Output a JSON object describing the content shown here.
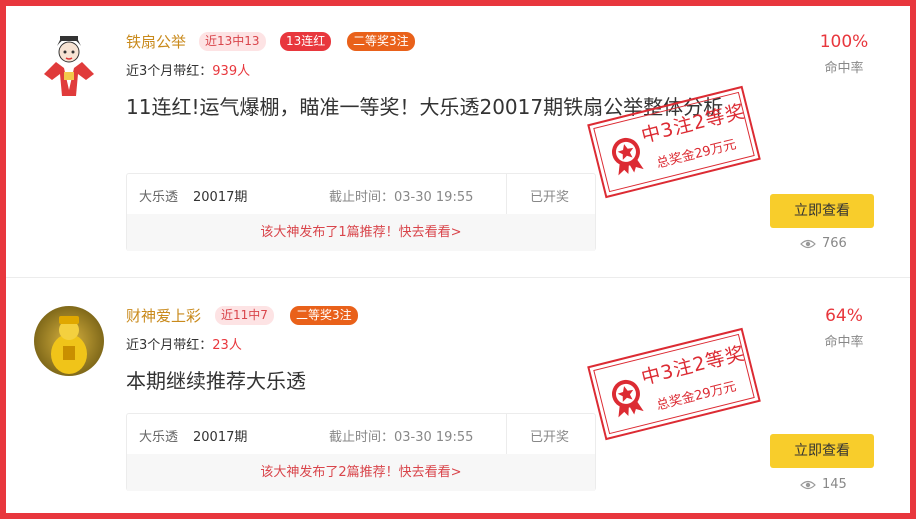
{
  "posts": [
    {
      "author": "铁扇公举",
      "tags": [
        "近13中13",
        "13连红",
        "二等奖3注"
      ],
      "stat_label": "近3个月带红：",
      "stat_value": "939人",
      "title": "11连红!运气爆棚，瞄准一等奖！大乐透20017期铁扇公举整体分析",
      "lottery": "大乐透",
      "issue": "20017期",
      "deadline": "截止时间：03-30 19:55",
      "status": "已开奖",
      "notice": "该大神发布了1篇推荐！快去看看>",
      "hit_rate": "100%",
      "hit_rate_label": "命中率",
      "button": "立即查看",
      "views": "766",
      "stamp_line1": "中3注2等奖",
      "stamp_line2": "总奖金29万元"
    },
    {
      "author": "财神爱上彩",
      "tags": [
        "近11中7",
        "二等奖3注"
      ],
      "stat_label": "近3个月带红：",
      "stat_value": "23人",
      "title": "本期继续推荐大乐透",
      "lottery": "大乐透",
      "issue": "20017期",
      "deadline": "截止时间：03-30 19:55",
      "status": "已开奖",
      "notice": "该大神发布了2篇推荐！快去看看>",
      "hit_rate": "64%",
      "hit_rate_label": "命中率",
      "button": "立即查看",
      "views": "145",
      "stamp_line1": "中3注2等奖",
      "stamp_line2": "总奖金29万元"
    }
  ],
  "colors": {
    "frame": "#e8373d",
    "accent": "#e8373d",
    "author": "#c98a1c",
    "button": "#f8cd2b",
    "tag_orange": "#e9611a"
  },
  "icons": {
    "views": "eye-icon",
    "stamp_badge": "star-rosette-icon"
  }
}
